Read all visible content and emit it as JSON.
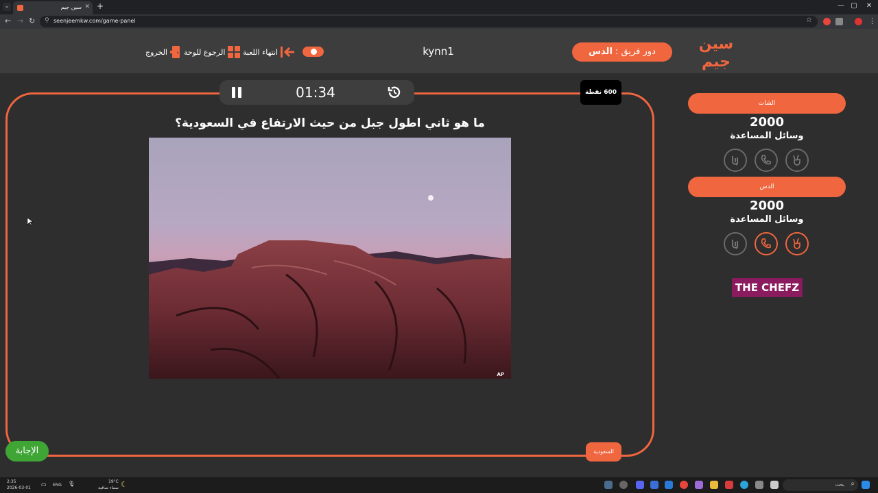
{
  "browser": {
    "tab_title": "سين جيم",
    "tab_close": "✕",
    "new_tab": "+",
    "url": "seenjeemkw.com/game-panel",
    "window_controls": [
      "—",
      "▢",
      "✕"
    ]
  },
  "header": {
    "logo_line1": "سين",
    "logo_line2": "جيم",
    "turn_prefix": "دور فريق : ",
    "turn_team": "الدس",
    "username": "kynn1",
    "end_game": "انتهاء اللعبة",
    "back_to_board": "الرجوع للوحة",
    "exit": "الخروج"
  },
  "game": {
    "timer": "01:34",
    "points": "600 نقطة",
    "question": "ما هو ثاني اطول جبل من حيث الارتفاع في السعودية؟",
    "image_credit": "AP",
    "category": "السعودية",
    "answer_button": "الإجابة"
  },
  "teams": [
    {
      "name": "الشات",
      "score": "2000",
      "aids_label": "وسائل المساعدة",
      "aids": [
        {
          "icon": "two-hands-icon",
          "active": false
        },
        {
          "icon": "phone-icon",
          "active": false
        },
        {
          "icon": "peace-hand-icon",
          "active": false
        }
      ]
    },
    {
      "name": "الدس",
      "score": "2000",
      "aids_label": "وسائل المساعدة",
      "aids": [
        {
          "icon": "two-hands-icon",
          "active": false
        },
        {
          "icon": "phone-icon",
          "active": true
        },
        {
          "icon": "peace-hand-icon",
          "active": true
        }
      ]
    }
  ],
  "sponsor": "THE CHEFZ",
  "taskbar": {
    "time": "2:35",
    "date": "2026-03-01",
    "lang": "ENG",
    "temp": "19°C",
    "weather": "سماء صافية",
    "search": "بحث"
  },
  "colors": {
    "accent": "#f0663f",
    "answer": "#3fa535",
    "background": "#2e2e2e",
    "header": "#3d3d3d",
    "sponsor": "#8a1b5e"
  }
}
